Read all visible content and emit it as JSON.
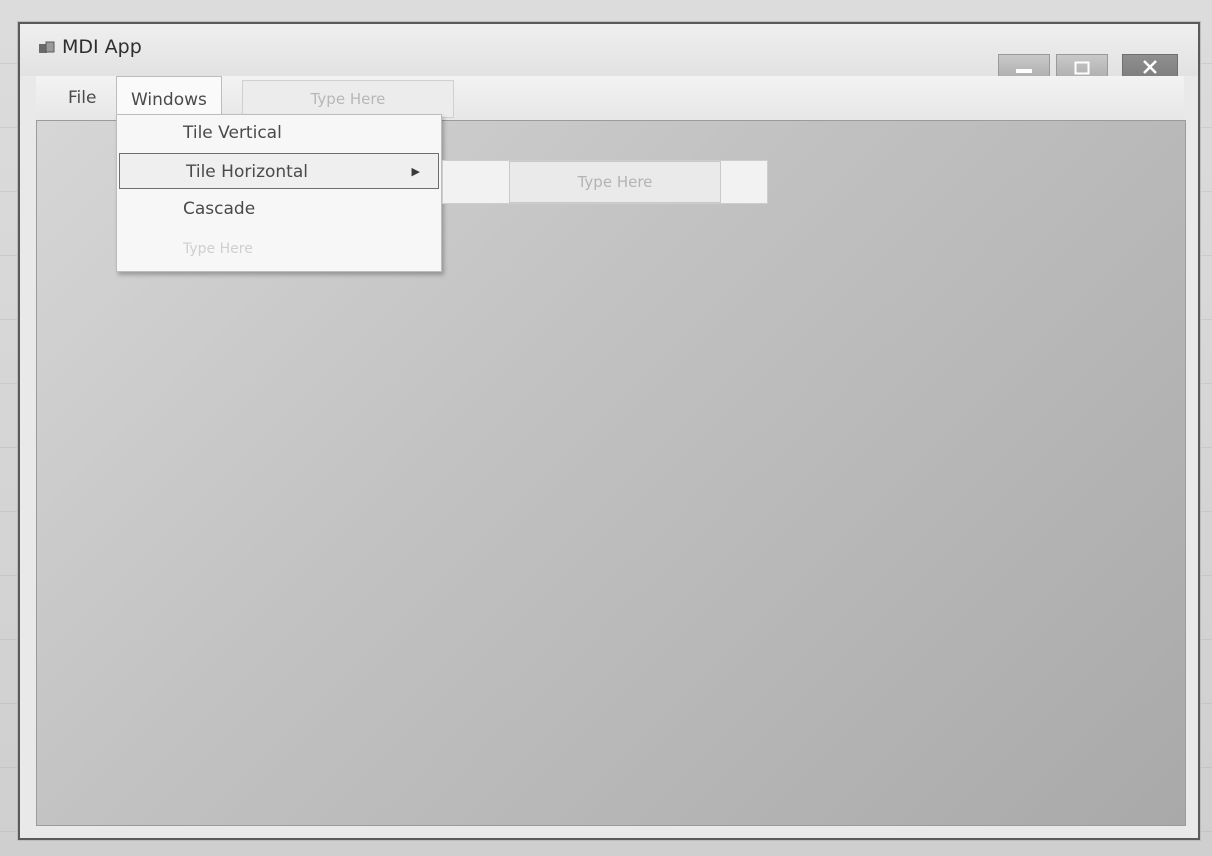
{
  "window": {
    "title": "MDI App"
  },
  "menubar": {
    "items": [
      {
        "label": "File"
      },
      {
        "label": "Windows"
      }
    ],
    "type_here": "Type Here"
  },
  "windows_menu": {
    "items": [
      {
        "label": "Tile Vertical"
      },
      {
        "label": "Tile Horizontal",
        "has_submenu": true
      },
      {
        "label": "Cascade"
      }
    ],
    "type_here": "Type Here"
  },
  "submenu": {
    "type_here": "Type Here"
  },
  "icons": {
    "app": "app-icon",
    "minimize": "minimize-icon",
    "maximize": "maximize-icon",
    "close": "close-icon",
    "submenu_arrow": "chevron-right-icon"
  },
  "colors": {
    "client_area": "#c2c2c2",
    "menu_background": "#f7f7f7"
  }
}
